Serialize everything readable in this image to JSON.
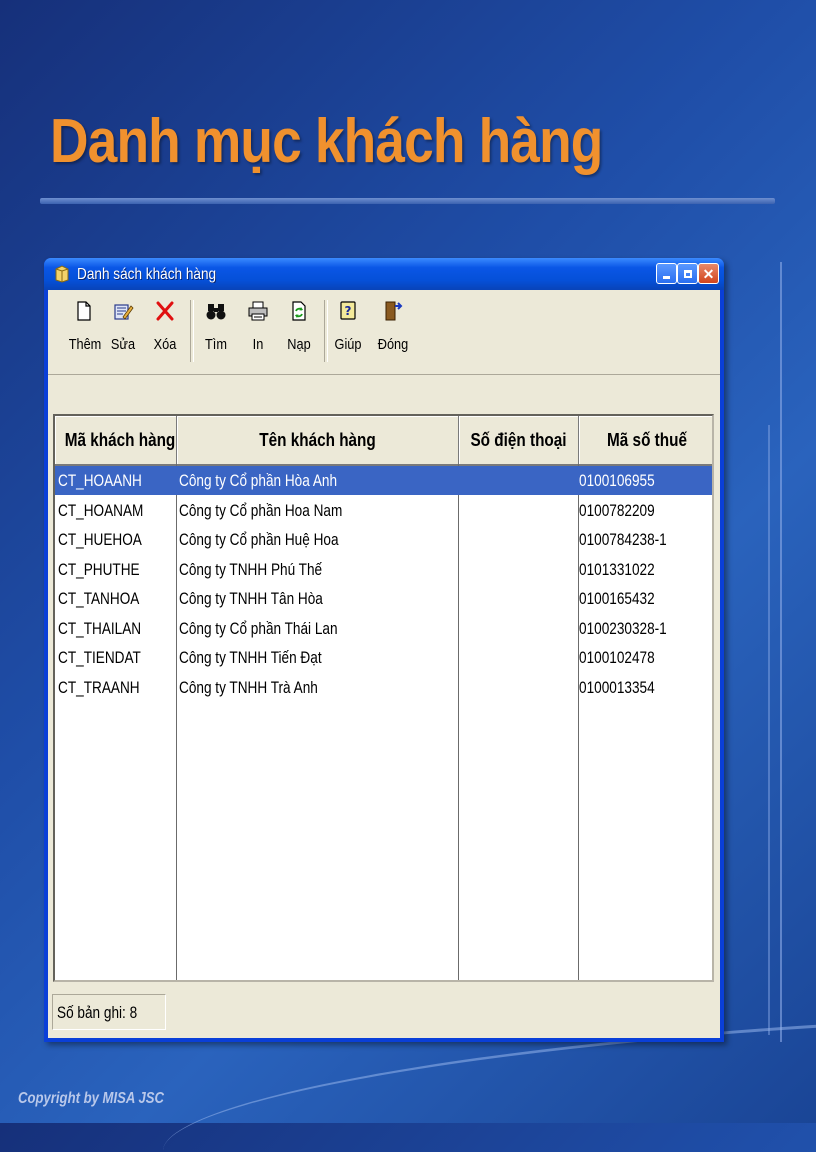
{
  "slide": {
    "title": "Danh mục khách hàng",
    "copyright": "Copyright by MISA JSC"
  },
  "window": {
    "title": "Danh sách khách hàng",
    "title_icon": "folder-box-icon"
  },
  "toolbar": {
    "items": [
      {
        "label": "Thêm",
        "icon": "new-document-icon"
      },
      {
        "label": "Sửa",
        "icon": "edit-icon"
      },
      {
        "label": "Xóa",
        "icon": "delete-x-icon"
      },
      {
        "label": "Tìm",
        "icon": "binoculars-icon"
      },
      {
        "label": "In",
        "icon": "printer-icon"
      },
      {
        "label": "Nạp",
        "icon": "refresh-icon"
      },
      {
        "label": "Giúp",
        "icon": "help-icon"
      },
      {
        "label": "Đóng",
        "icon": "exit-door-icon"
      }
    ]
  },
  "grid": {
    "columns": [
      "Mã khách hàng",
      "Tên khách hàng",
      "Số điện thoại",
      "Mã số thuế"
    ],
    "rows": [
      {
        "code": "CT_HOAANH",
        "name": "Công ty Cổ phần Hòa Anh",
        "phone": "",
        "tax": "0100106955",
        "selected": true
      },
      {
        "code": "CT_HOANAM",
        "name": "Công ty Cổ phần Hoa Nam",
        "phone": "",
        "tax": "0100782209"
      },
      {
        "code": "CT_HUEHOA",
        "name": "Công ty Cổ phần Huệ Hoa",
        "phone": "",
        "tax": "0100784238-1"
      },
      {
        "code": "CT_PHUTHE",
        "name": "Công ty TNHH Phú Thế",
        "phone": "",
        "tax": "0101331022"
      },
      {
        "code": "CT_TANHOA",
        "name": "Công ty TNHH Tân Hòa",
        "phone": "",
        "tax": "0100165432"
      },
      {
        "code": "CT_THAILAN",
        "name": "Công ty Cổ phần Thái Lan",
        "phone": "",
        "tax": "0100230328-1"
      },
      {
        "code": "CT_TIENDAT",
        "name": "Công ty TNHH Tiến Đạt",
        "phone": "",
        "tax": "0100102478"
      },
      {
        "code": "CT_TRAANH",
        "name": "Công ty TNHH Trà Anh",
        "phone": "",
        "tax": "0100013354"
      }
    ]
  },
  "status": {
    "records": "Số bản ghi: 8"
  },
  "colors": {
    "title_orange": "#f0912e",
    "selection_blue": "#3a65c4",
    "xp_titlebar": "#0550d8"
  }
}
